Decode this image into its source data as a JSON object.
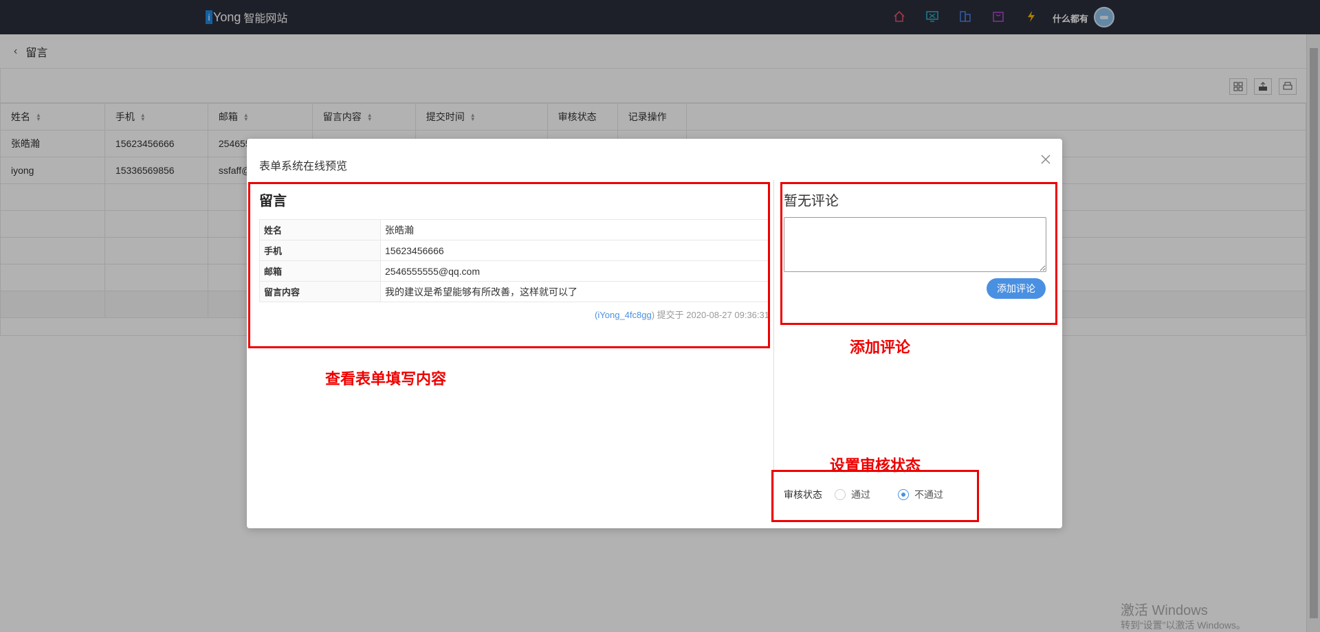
{
  "topbar": {
    "brand_mark": "i",
    "brand_rest": "Yong",
    "brand_cn": "智能网站",
    "user_name": "什么都有",
    "icons": [
      "home-icon",
      "monitor-icon",
      "building-icon",
      "bag-icon",
      "lightning-icon"
    ]
  },
  "page": {
    "title": "留言",
    "columns": [
      "姓名",
      "手机",
      "邮箱",
      "留言内容",
      "提交时间",
      "审核状态",
      "记录操作"
    ],
    "rows": [
      [
        "张皓瀚",
        "15623456666",
        "254655",
        "",
        "",
        "",
        ""
      ],
      [
        "iyong",
        "15336569856",
        "ssfaff@",
        "",
        "",
        "",
        ""
      ]
    ]
  },
  "modal": {
    "title": "表单系统在线预览",
    "form_title": "留言",
    "fields": [
      {
        "key": "姓名",
        "value": "张皓瀚"
      },
      {
        "key": "手机",
        "value": "15623456666"
      },
      {
        "key": "邮箱",
        "value": "2546555555@qq.com"
      },
      {
        "key": "留言内容",
        "value": "我的建议是希望能够有所改善，这样就可以了"
      }
    ],
    "submit_open": "(",
    "submit_user": "iYong_4fc8gg",
    "submit_rest": ") 提交于 2020-08-27 09:36:31",
    "no_comment": "暂无评论",
    "comment_placeholder": "",
    "add_comment_button": "添加评论",
    "review_label": "审核状态",
    "review_options": [
      "通过",
      "不通过"
    ],
    "review_selected": "不通过"
  },
  "annotations": {
    "view_form": "查看表单填写内容",
    "add_comment": "添加评论",
    "set_review": "设置审核状态"
  },
  "watermark": {
    "line1": "激活 Windows",
    "line2": "转到“设置”以激活 Windows。"
  },
  "colors": {
    "topbar_bg": "#2b2e3b",
    "accent": "#4a90e2",
    "annotation": "#e00000"
  }
}
